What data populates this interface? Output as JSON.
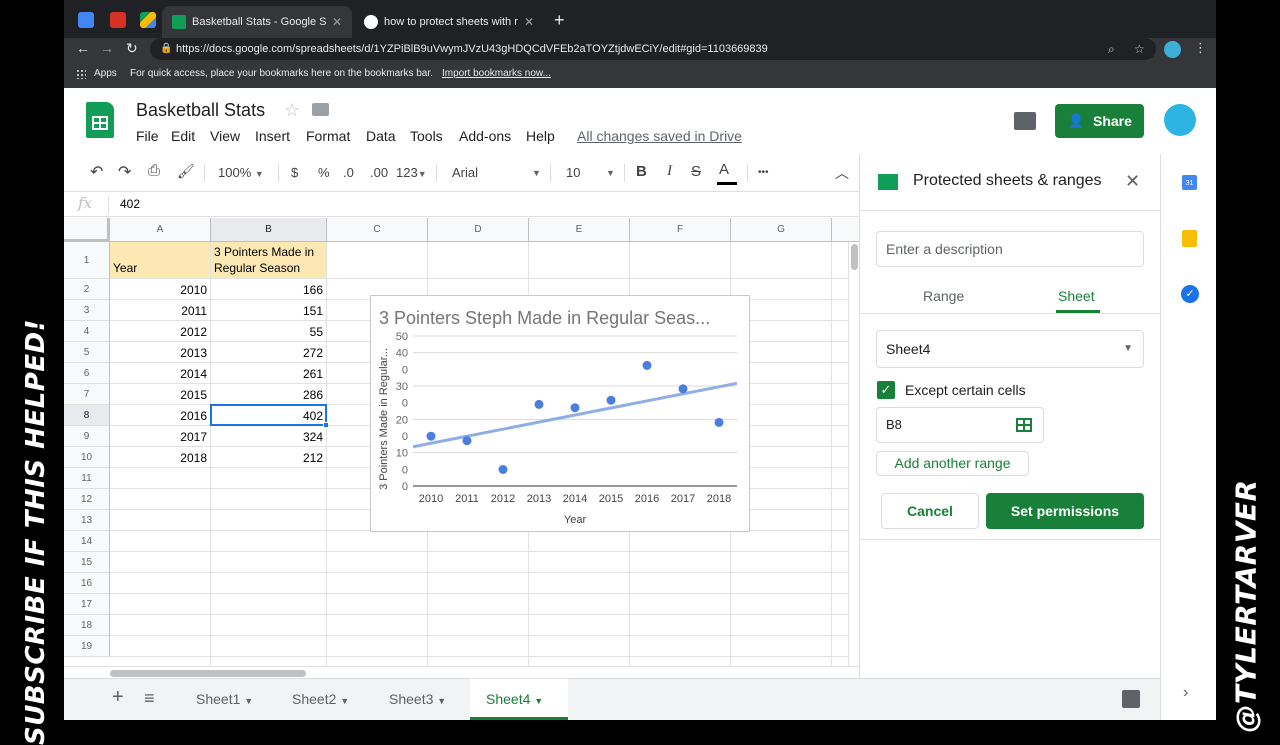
{
  "overlay": {
    "left_text": "SUBSCRIBE IF THIS HELPED!",
    "right_text": "@TYLERTARVER"
  },
  "browser": {
    "tabs": [
      {
        "title": "Basketball Stats - Google Sheets",
        "active": true
      },
      {
        "title": "how to protect sheets with ranges",
        "active": false
      }
    ],
    "url": "https://docs.google.com/spreadsheets/d/1YZPiBlB9uVwymJVzU43gHDQCdVFEb2aTOYZtjdwECiY/edit#gid=1103669839",
    "bookmarks": {
      "apps_label": "Apps",
      "hint": "For quick access, place your bookmarks here on the bookmarks bar.",
      "import_link": "Import bookmarks now..."
    }
  },
  "doc": {
    "title": "Basketball Stats",
    "menu": [
      "File",
      "Edit",
      "View",
      "Insert",
      "Format",
      "Data",
      "Tools",
      "Add-ons",
      "Help"
    ],
    "save_status": "All changes saved in Drive",
    "share_label": "Share"
  },
  "toolbar": {
    "zoom": "100%",
    "currency": "$",
    "percent": "%",
    "dec_less": ".0",
    "dec_more": ".00",
    "more_formats": "123",
    "font": "Arial",
    "font_size": "10",
    "bold": "B",
    "italic": "I",
    "strike": "S",
    "text_color": "A",
    "more": "•••"
  },
  "formula_bar": {
    "fx": "fx",
    "value": "402"
  },
  "grid": {
    "columns": [
      "A",
      "B",
      "C",
      "D",
      "E",
      "F",
      "G"
    ],
    "rows": [
      "1",
      "2",
      "3",
      "4",
      "5",
      "6",
      "7",
      "8",
      "9",
      "10",
      "11",
      "12",
      "13",
      "14",
      "15",
      "16",
      "17",
      "18",
      "19"
    ],
    "header": {
      "a": "Year",
      "b": "3 Pointers Made in Regular Season"
    },
    "data": [
      {
        "year": "2010",
        "made": "166"
      },
      {
        "year": "2011",
        "made": "151"
      },
      {
        "year": "2012",
        "made": "55"
      },
      {
        "year": "2013",
        "made": "272"
      },
      {
        "year": "2014",
        "made": "261"
      },
      {
        "year": "2015",
        "made": "286"
      },
      {
        "year": "2016",
        "made": "402"
      },
      {
        "year": "2017",
        "made": "324"
      },
      {
        "year": "2018",
        "made": "212"
      }
    ],
    "selected_cell": "B8"
  },
  "chart_data": {
    "type": "scatter",
    "title": "3 Pointers Steph Made in Regular Seas...",
    "xlabel": "Year",
    "ylabel": "3 Pointers Made in Regular...",
    "x": [
      2010,
      2011,
      2012,
      2013,
      2014,
      2015,
      2016,
      2017,
      2018
    ],
    "y": [
      166,
      151,
      55,
      272,
      261,
      286,
      402,
      324,
      212
    ],
    "ylim": [
      0,
      500
    ],
    "y_tick_labels": [
      "50",
      "40",
      "0",
      "30",
      "0",
      "20",
      "0",
      "10",
      "0",
      "0"
    ],
    "trendline": true,
    "grid": true,
    "point_color": "#4a7fe0",
    "trend_color": "#8eaee6"
  },
  "sheet_tabs": {
    "tabs": [
      "Sheet1",
      "Sheet2",
      "Sheet3",
      "Sheet4"
    ],
    "active": "Sheet4"
  },
  "panel": {
    "title": "Protected sheets & ranges",
    "description_placeholder": "Enter a description",
    "tab_range": "Range",
    "tab_sheet": "Sheet",
    "sheet_selected": "Sheet4",
    "except_label": "Except certain cells",
    "except_checked": true,
    "range_value": "B8",
    "add_range": "Add another range",
    "cancel": "Cancel",
    "set_permissions": "Set permissions"
  },
  "colors": {
    "green": "#188038",
    "header_fill": "#fce8b2",
    "select_blue": "#1a73e8"
  }
}
